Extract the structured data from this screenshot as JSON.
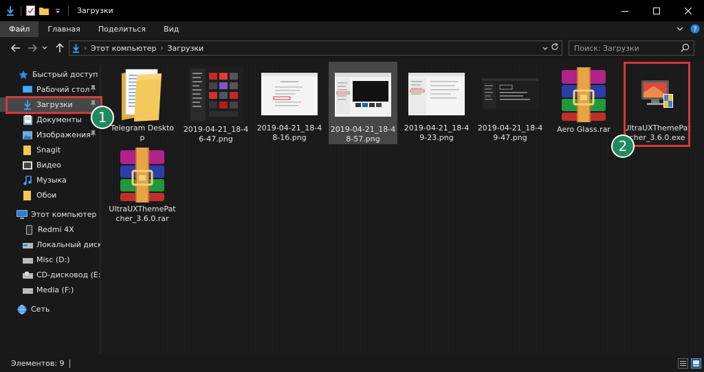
{
  "window": {
    "title": "Загрузки"
  },
  "ribbon": {
    "tabs": [
      "Файл",
      "Главная",
      "Поделиться",
      "Вид"
    ]
  },
  "address": {
    "crumbs": [
      "Этот компьютер",
      "Загрузки"
    ]
  },
  "search": {
    "placeholder": "Поиск: Загрузки"
  },
  "nav": {
    "quick_access": "Быстрый доступ",
    "items": [
      {
        "label": "Рабочий стол",
        "icon": "desktop-icon",
        "pinned": true
      },
      {
        "label": "Загрузки",
        "icon": "downloads-icon",
        "pinned": true
      },
      {
        "label": "Документы",
        "icon": "documents-icon",
        "pinned": true
      },
      {
        "label": "Изображения",
        "icon": "pictures-icon",
        "pinned": true
      },
      {
        "label": "Snagit",
        "icon": "folder-icon",
        "pinned": false
      },
      {
        "label": "Видео",
        "icon": "videos-icon",
        "pinned": false
      },
      {
        "label": "Музыка",
        "icon": "music-icon",
        "pinned": false
      },
      {
        "label": "Обои",
        "icon": "folder-icon",
        "pinned": false
      }
    ],
    "this_pc": "Этот компьютер",
    "drives": [
      {
        "label": "Redmi 4X",
        "icon": "phone-icon"
      },
      {
        "label": "Локальный диск (C",
        "icon": "drive-icon"
      },
      {
        "label": "Misc (D:)",
        "icon": "drive-icon"
      },
      {
        "label": "CD-дисковод (E:)",
        "icon": "cd-drive-icon"
      },
      {
        "label": "Media (F:)",
        "icon": "drive-icon"
      }
    ],
    "network": "Сеть"
  },
  "files": [
    {
      "name": "Telegram Desktop",
      "type": "folder"
    },
    {
      "name": "2019-04-21_18-46-47.png",
      "type": "png-dark"
    },
    {
      "name": "2019-04-21_18-48-16.png",
      "type": "png-light"
    },
    {
      "name": "2019-04-21_18-48-57.png",
      "type": "png-mixed",
      "selected": true
    },
    {
      "name": "2019-04-21_18-49-23.png",
      "type": "png-light"
    },
    {
      "name": "2019-04-21_18-49-47.png",
      "type": "png-dark2"
    },
    {
      "name": "Aero Glass.rar",
      "type": "rar"
    },
    {
      "name": "UltraUXThemePatcher_3.6.0.exe",
      "type": "exe"
    },
    {
      "name": "UltraUXThemePatcher_3.6.0.rar",
      "type": "rar"
    }
  ],
  "annotations": {
    "badge1": "1",
    "badge2": "2",
    "color": "#d33a3a",
    "badge_color": "#1d8a5f"
  },
  "status": {
    "count": "Элементов: 9"
  }
}
